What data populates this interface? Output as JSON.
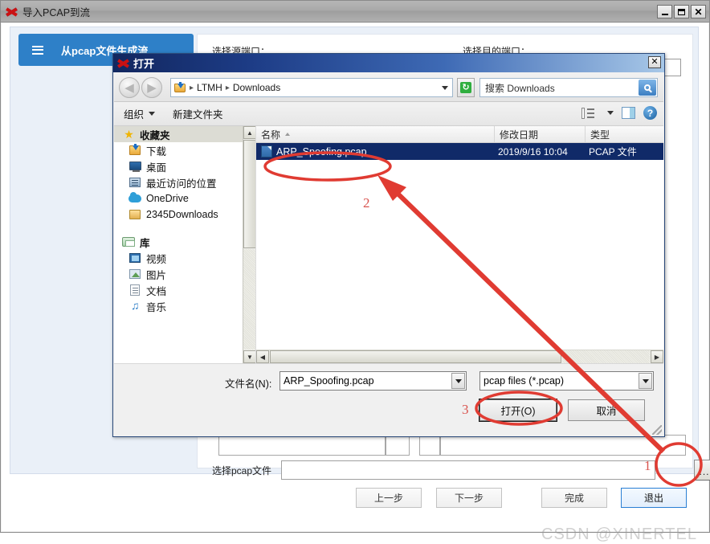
{
  "main_window": {
    "title": "导入PCAP到流",
    "logo_icon": "x-logo-icon",
    "window_buttons": {
      "minimize": "minimize-icon",
      "maximize": "maximize-icon",
      "close": "close-icon"
    },
    "step_tab": {
      "menu_icon": "hamburger-icon",
      "label": "从pcap文件生成流"
    },
    "form": {
      "src_port_label": "选择源端口：",
      "dst_port_label": "选择目的端口：",
      "src_port_value": "",
      "dst_port_value": "",
      "pcap_label": "选择pcap文件",
      "pcap_value": "",
      "browse_label": "..."
    },
    "buttons": {
      "prev": "上一步",
      "next": "下一步",
      "finish": "完成",
      "exit": "退出"
    },
    "watermark": "CSDN @XINERTEL"
  },
  "open_dialog": {
    "title": "打开",
    "logo_icon": "x-logo-icon",
    "close_label": "✕",
    "nav": {
      "back_icon": "arrow-left-icon",
      "forward_icon": "arrow-right-icon",
      "breadcrumb": [
        "LTMH",
        "Downloads"
      ],
      "folder_icon": "downloads-folder-icon",
      "refresh_icon": "refresh-icon",
      "search_placeholder": "搜索 Downloads",
      "search_icon": "search-icon"
    },
    "toolbar": {
      "organize": "组织",
      "new_folder": "新建文件夹",
      "view_icon": "view-mode-icon",
      "preview_icon": "preview-pane-icon",
      "help_icon": "help-icon"
    },
    "places": [
      {
        "label": "收藏夹",
        "icon": "star-icon",
        "header": true,
        "selected": true
      },
      {
        "label": "下载",
        "icon": "downloads-icon",
        "header": false,
        "selected": false
      },
      {
        "label": "桌面",
        "icon": "desktop-icon",
        "header": false,
        "selected": false
      },
      {
        "label": "最近访问的位置",
        "icon": "recent-places-icon",
        "header": false,
        "selected": false
      },
      {
        "label": "OneDrive",
        "icon": "onedrive-icon",
        "header": false,
        "selected": false
      },
      {
        "label": "2345Downloads",
        "icon": "folder-icon",
        "header": false,
        "selected": false
      },
      {
        "label": "库",
        "icon": "library-icon",
        "header": true,
        "selected": false
      },
      {
        "label": "视频",
        "icon": "video-icon",
        "header": false,
        "selected": false
      },
      {
        "label": "图片",
        "icon": "pictures-icon",
        "header": false,
        "selected": false
      },
      {
        "label": "文档",
        "icon": "documents-icon",
        "header": false,
        "selected": false
      },
      {
        "label": "音乐",
        "icon": "music-icon",
        "header": false,
        "selected": false
      }
    ],
    "columns": {
      "name": "名称",
      "date": "修改日期",
      "type": "类型"
    },
    "files": [
      {
        "name": "ARP_Spoofing.pcap",
        "date": "2019/9/16 10:04",
        "type": "PCAP 文件",
        "icon": "pcap-file-icon",
        "selected": true
      }
    ],
    "footer": {
      "filename_label": "文件名(N):",
      "filename_value": "ARP_Spoofing.pcap",
      "filter_value": "pcap files (*.pcap)",
      "open_button": "打开(O)",
      "cancel_button": "取消"
    }
  },
  "annotations": {
    "one": "1",
    "two": "2",
    "three": "3",
    "color": "#d9544f"
  }
}
